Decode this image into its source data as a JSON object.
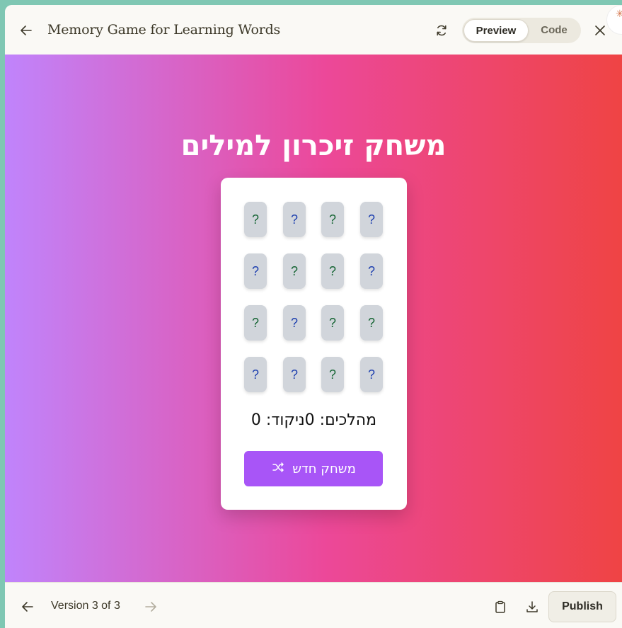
{
  "header": {
    "title": "Memory Game for Learning Words",
    "tabs": [
      {
        "label": "Preview",
        "active": true
      },
      {
        "label": "Code",
        "active": false
      }
    ]
  },
  "game": {
    "title": "משחק זיכרון למילים",
    "tiles": [
      {
        "symbol": "?",
        "color": "green"
      },
      {
        "symbol": "?",
        "color": "blue"
      },
      {
        "symbol": "?",
        "color": "green"
      },
      {
        "symbol": "?",
        "color": "blue"
      },
      {
        "symbol": "?",
        "color": "blue"
      },
      {
        "symbol": "?",
        "color": "green"
      },
      {
        "symbol": "?",
        "color": "green"
      },
      {
        "symbol": "?",
        "color": "blue"
      },
      {
        "symbol": "?",
        "color": "green"
      },
      {
        "symbol": "?",
        "color": "blue"
      },
      {
        "symbol": "?",
        "color": "green"
      },
      {
        "symbol": "?",
        "color": "green"
      },
      {
        "symbol": "?",
        "color": "blue"
      },
      {
        "symbol": "?",
        "color": "blue"
      },
      {
        "symbol": "?",
        "color": "green"
      },
      {
        "symbol": "?",
        "color": "blue"
      }
    ],
    "stats_text": "מהלכים: 0ניקוד: 0",
    "new_game_label": "משחק חדש",
    "new_game_icon": "shuffle-icon"
  },
  "footer": {
    "version_text": "Version 3 of 3",
    "publish_label": "Publish"
  },
  "colors": {
    "gradient_start": "#c084fc",
    "gradient_mid": "#ec4899",
    "gradient_end": "#ef4444",
    "button": "#a855f7",
    "tile_bg": "#d1d5db",
    "tile_blue": "#1e40af",
    "tile_green": "#166534"
  }
}
